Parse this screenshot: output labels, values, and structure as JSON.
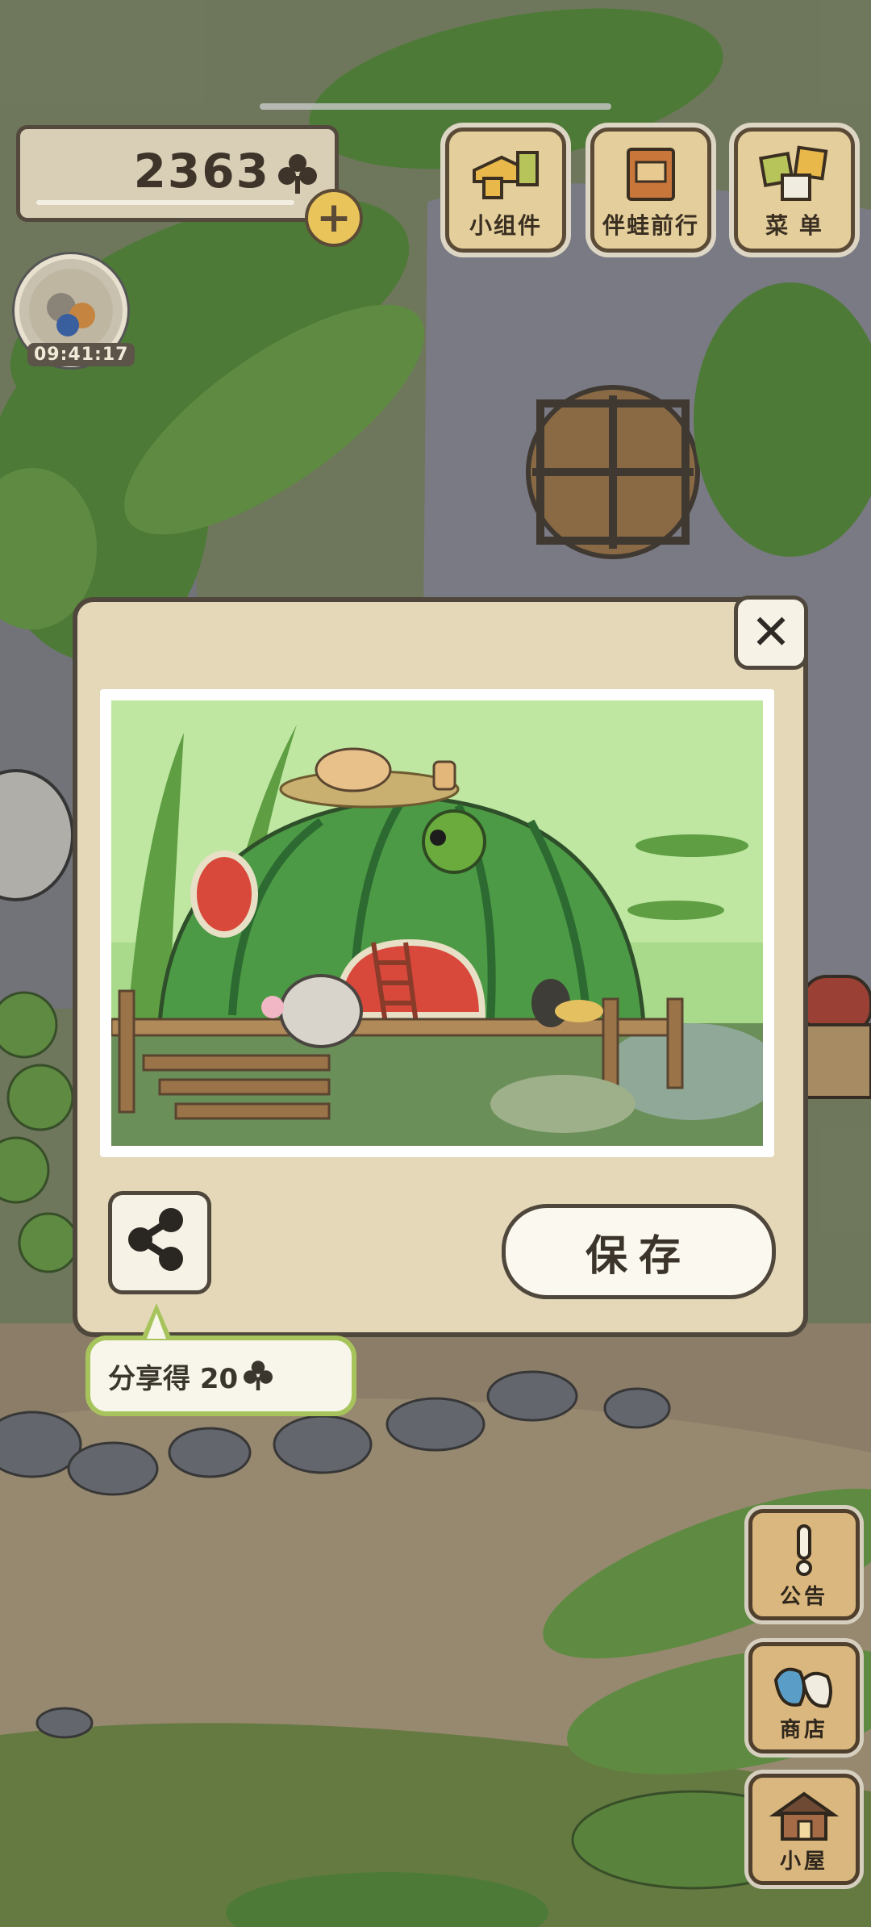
{
  "hud": {
    "clover_count": "2363",
    "timer": "09:41:17"
  },
  "top_buttons": [
    {
      "label": "小组件",
      "icon": "widget-icon"
    },
    {
      "label": "伴蛙前行",
      "icon": "journal-icon"
    },
    {
      "label": "菜 单",
      "icon": "menu-cards-icon"
    }
  ],
  "dialog": {
    "save_label": "保存",
    "share_reward": "分享得 20"
  },
  "side_buttons": [
    {
      "label": "公告",
      "icon": "exclamation-icon"
    },
    {
      "label": "商店",
      "icon": "shop-bag-icon"
    },
    {
      "label": "小屋",
      "icon": "house-icon"
    }
  ],
  "colors": {
    "dialog_bg": "#e4d8b8",
    "border": "#4f473b",
    "tooltip_border": "#a7c45c",
    "wood": "#d9b77e"
  }
}
